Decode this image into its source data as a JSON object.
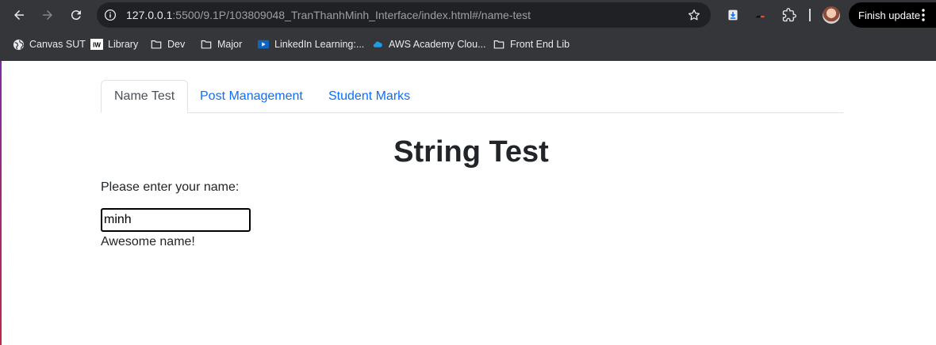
{
  "browser": {
    "url_host": "127.0.0.1",
    "url_path": ":5500/9.1P/103809048_TranThanhMinh_Interface/index.html#/name-test",
    "finish_update_label": "Finish update",
    "bookmarks": [
      {
        "label": "Canvas SUT",
        "icon": "globe-icon"
      },
      {
        "label": "Library",
        "icon": "iw-icon"
      },
      {
        "label": "Dev",
        "icon": "folder-icon"
      },
      {
        "label": "Major",
        "icon": "folder-icon"
      },
      {
        "label": "LinkedIn Learning:...",
        "icon": "play-icon"
      },
      {
        "label": "AWS Academy Clou...",
        "icon": "cloud-icon"
      },
      {
        "label": "Front End Lib",
        "icon": "folder-icon"
      }
    ]
  },
  "tabs": [
    {
      "label": "Name Test",
      "active": true
    },
    {
      "label": "Post Management",
      "active": false
    },
    {
      "label": "Student Marks",
      "active": false
    }
  ],
  "main": {
    "title": "String Test",
    "prompt": "Please enter your name:",
    "name_value": "minh",
    "feedback": "Awesome name!"
  },
  "colors": {
    "chrome_bg": "#35363a",
    "omnibox_bg": "#202124",
    "link": "#0d6efd",
    "text": "#212529"
  }
}
